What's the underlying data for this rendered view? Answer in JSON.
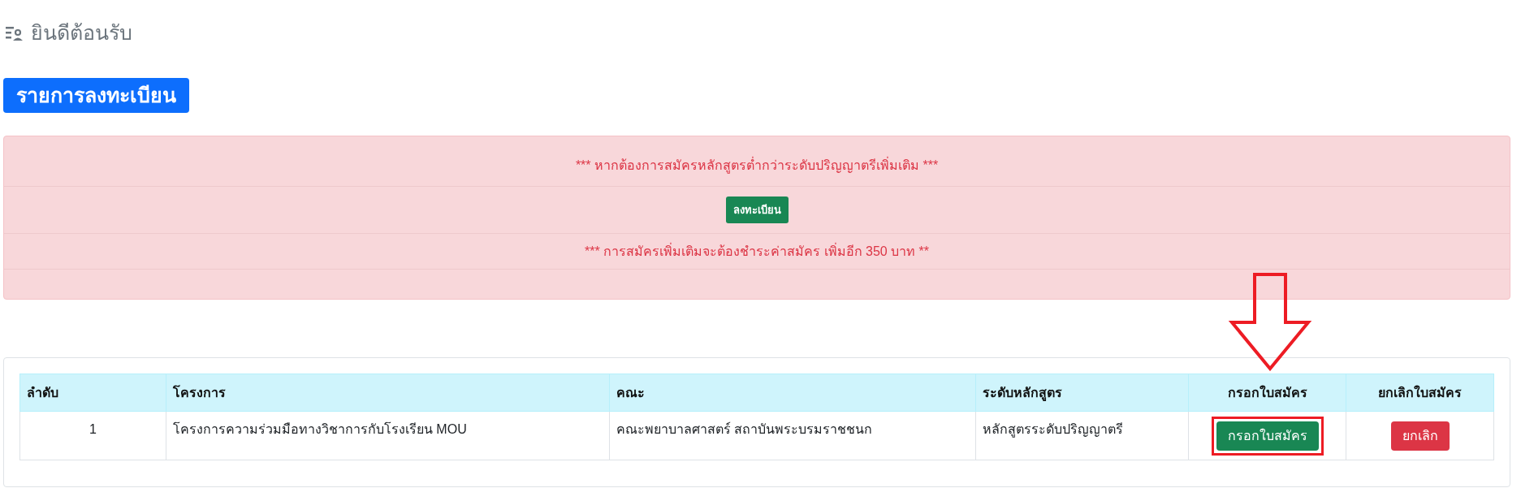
{
  "header": {
    "title": "ยินดีต้อนรับ"
  },
  "section_button": "รายการลงทะเบียน",
  "alert": {
    "line_1": "*** หากต้องการสมัครหลักสูตรต่ำกว่าระดับปริญญาตรีเพิ่มเติม ***",
    "button": "ลงทะเบียน",
    "line_2": "*** การสมัครเพิ่มเติมจะต้องชำระค่าสมัคร เพิ่มอีก 350 บาท **"
  },
  "table": {
    "columns": [
      "ลำดับ",
      "โครงการ",
      "คณะ",
      "ระดับหลักสูตร",
      "กรอกใบสมัคร",
      "ยกเลิกใบสมัคร"
    ],
    "rows": [
      {
        "no": "1",
        "project": "โครงการความร่วมมือทางวิชาการกับโรงเรียน MOU",
        "faculty": "คณะพยาบาลศาสตร์ สถาบันพระบรมราชชนก",
        "level": "หลักสูตรระดับปริญญาตรี",
        "fill_button": "กรอกใบสมัคร",
        "cancel_button": "ยกเลิก",
        "highlighted": true
      }
    ]
  }
}
